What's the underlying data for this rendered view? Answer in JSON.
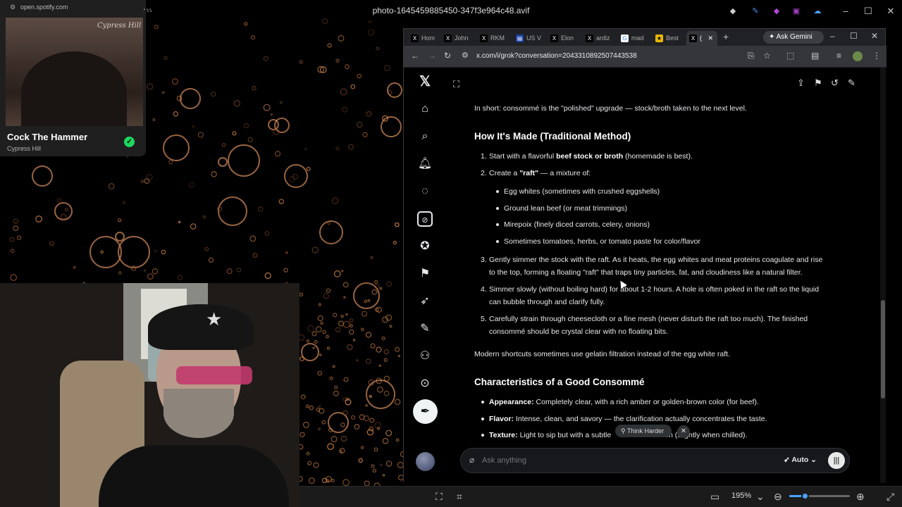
{
  "viewer": {
    "title": "photo-1645459885450-347f3e964c48.avif",
    "zoom": "195%",
    "zoom_level_fraction": 0.27
  },
  "spotify": {
    "url": "open.spotify.com",
    "album_text": "Cypress Hill",
    "track": "Cock The Hammer",
    "artist": "Cypress Hill",
    "check_icon": "check-icon"
  },
  "browser": {
    "tabs": [
      {
        "icon": "x-logo",
        "label": "Hom"
      },
      {
        "icon": "x-logo",
        "label": "John"
      },
      {
        "icon": "x-logo",
        "label": "RKM"
      },
      {
        "icon": "us-flag",
        "label": "US V"
      },
      {
        "icon": "x-logo",
        "label": "Elon"
      },
      {
        "icon": "x-logo",
        "label": "ardiz"
      },
      {
        "icon": "google-logo",
        "label": "mad"
      },
      {
        "icon": "bookmark",
        "label": "Best"
      },
      {
        "icon": "x-logo",
        "label": "("
      }
    ],
    "gemini_label": "Ask Gemini",
    "url": "x.com/i/grok?conversation=2043310892507443538"
  },
  "content": {
    "intro": [
      "In short: consommé is the \"polished\" upgrade — stock/broth taken to the next level."
    ],
    "heading1": "How It's Made (Traditional Method)",
    "steps": [
      {
        "num": "1.",
        "pre": "Start with a flavorful ",
        "bold": "beef stock or broth",
        "post": " (homemade is best)."
      },
      {
        "num": "2.",
        "pre": "Create a ",
        "bold": "\"raft\"",
        "post": " — a mixture of:"
      }
    ],
    "raft_items": [
      "Egg whites (sometimes with crushed eggshells)",
      "Ground lean beef (or meat trimmings)",
      "Mirepoix (finely diced carrots, celery, onions)",
      "Sometimes tomatoes, herbs, or tomato paste for color/flavor"
    ],
    "steps2": [
      {
        "num": "3.",
        "lines": [
          "Gently simmer the stock with the raft. As it heats, the egg whites and meat proteins coagulate and rise",
          "to the top, forming a floating \"raft\" that traps tiny particles, fat, and cloudiness like a natural filter."
        ]
      },
      {
        "num": "4.",
        "lines": [
          "Simmer slowly (without boiling hard) for about 1-2 hours. A hole is often poked in the raft so the liquid",
          "can bubble through and clarify fully."
        ]
      },
      {
        "num": "5.",
        "lines": [
          "Carefully strain through cheesecloth or a fine mesh (never disturb the raft too much). The finished",
          "consommé should be crystal clear with no floating bits."
        ]
      }
    ],
    "modern": "Modern shortcuts sometimes use gelatin filtration instead of the egg white raft.",
    "heading2": "Characteristics of a Good Consommé",
    "characteristics": [
      {
        "label": "Appearance:",
        "text": " Completely clear, with a rich amber or golden-brown color (for beef)."
      },
      {
        "label": "Flavor:",
        "text": " Intense, clean, and savory — the clarification actually concentrates the taste."
      },
      {
        "label": "Texture:",
        "text": " Light to sip but with a subtle",
        "tail": "en (slightly when chilled)."
      }
    ]
  },
  "composer": {
    "placeholder": "Ask anything",
    "mode": "Auto",
    "think_harder": "Think Harder"
  }
}
